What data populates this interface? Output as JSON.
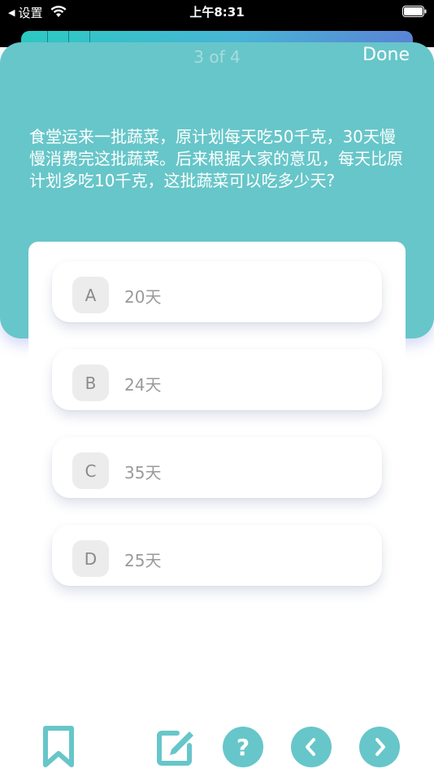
{
  "status_bar": {
    "back_label": "设置",
    "time": "上午8:31"
  },
  "sheet": {
    "page_indicator": "3 of 4",
    "done_label": "Done",
    "question": "食堂运来一批蔬菜，原计划每天吃50千克，30天慢慢消费完这批蔬菜。后来根据大家的意见，每天比原计划多吃10千克，这批蔬菜可以吃多少天?"
  },
  "options": [
    {
      "letter": "A",
      "text": "20天"
    },
    {
      "letter": "B",
      "text": "24天"
    },
    {
      "letter": "C",
      "text": "35天"
    },
    {
      "letter": "D",
      "text": "25天"
    }
  ],
  "toolbar": {
    "help_label": "?",
    "icons": [
      "bookmark-icon",
      "edit-icon",
      "help-icon",
      "chevron-left-icon",
      "chevron-right-icon"
    ]
  },
  "colors": {
    "accent": "#67c6c9",
    "status_bar": "#000000",
    "option_letter_bg": "#ececec",
    "option_text": "#9a9a9a"
  }
}
